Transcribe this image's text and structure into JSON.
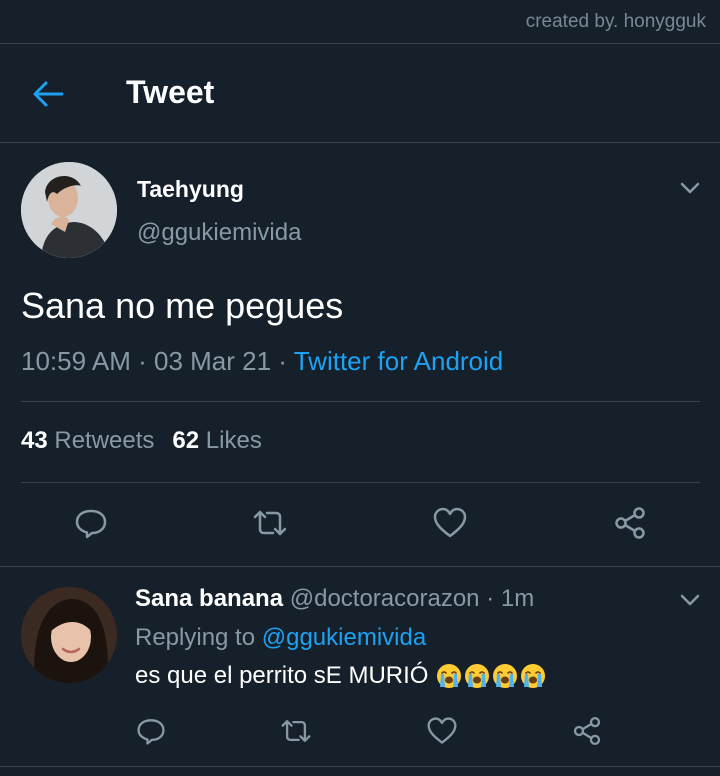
{
  "credit": "created by. honygguk",
  "header": {
    "title": "Tweet"
  },
  "tweet": {
    "author_name": "Taehyung",
    "author_handle": "@ggukiemivida",
    "text": "Sana no me pegues",
    "time": "10:59 AM",
    "date": "03 Mar 21",
    "source": "Twitter for Android",
    "retweets_count": "43",
    "retweets_label": "Retweets",
    "likes_count": "62",
    "likes_label": "Likes"
  },
  "reply": {
    "author_name": "Sana banana",
    "author_handle": "@doctoracorazon",
    "time": "1m",
    "replying_prefix": "Replying to",
    "replying_to": "@ggukiemivida",
    "text": "es que el perrito sE MURIÓ"
  },
  "colors": {
    "background": "#15202b",
    "accent": "#1da1f2",
    "muted": "#8899a6",
    "divider": "#38444d"
  },
  "icons": [
    "back-arrow-icon",
    "chevron-down-icon",
    "reply-icon",
    "retweet-icon",
    "like-icon",
    "share-icon",
    "loudly-crying-face-emoji"
  ]
}
